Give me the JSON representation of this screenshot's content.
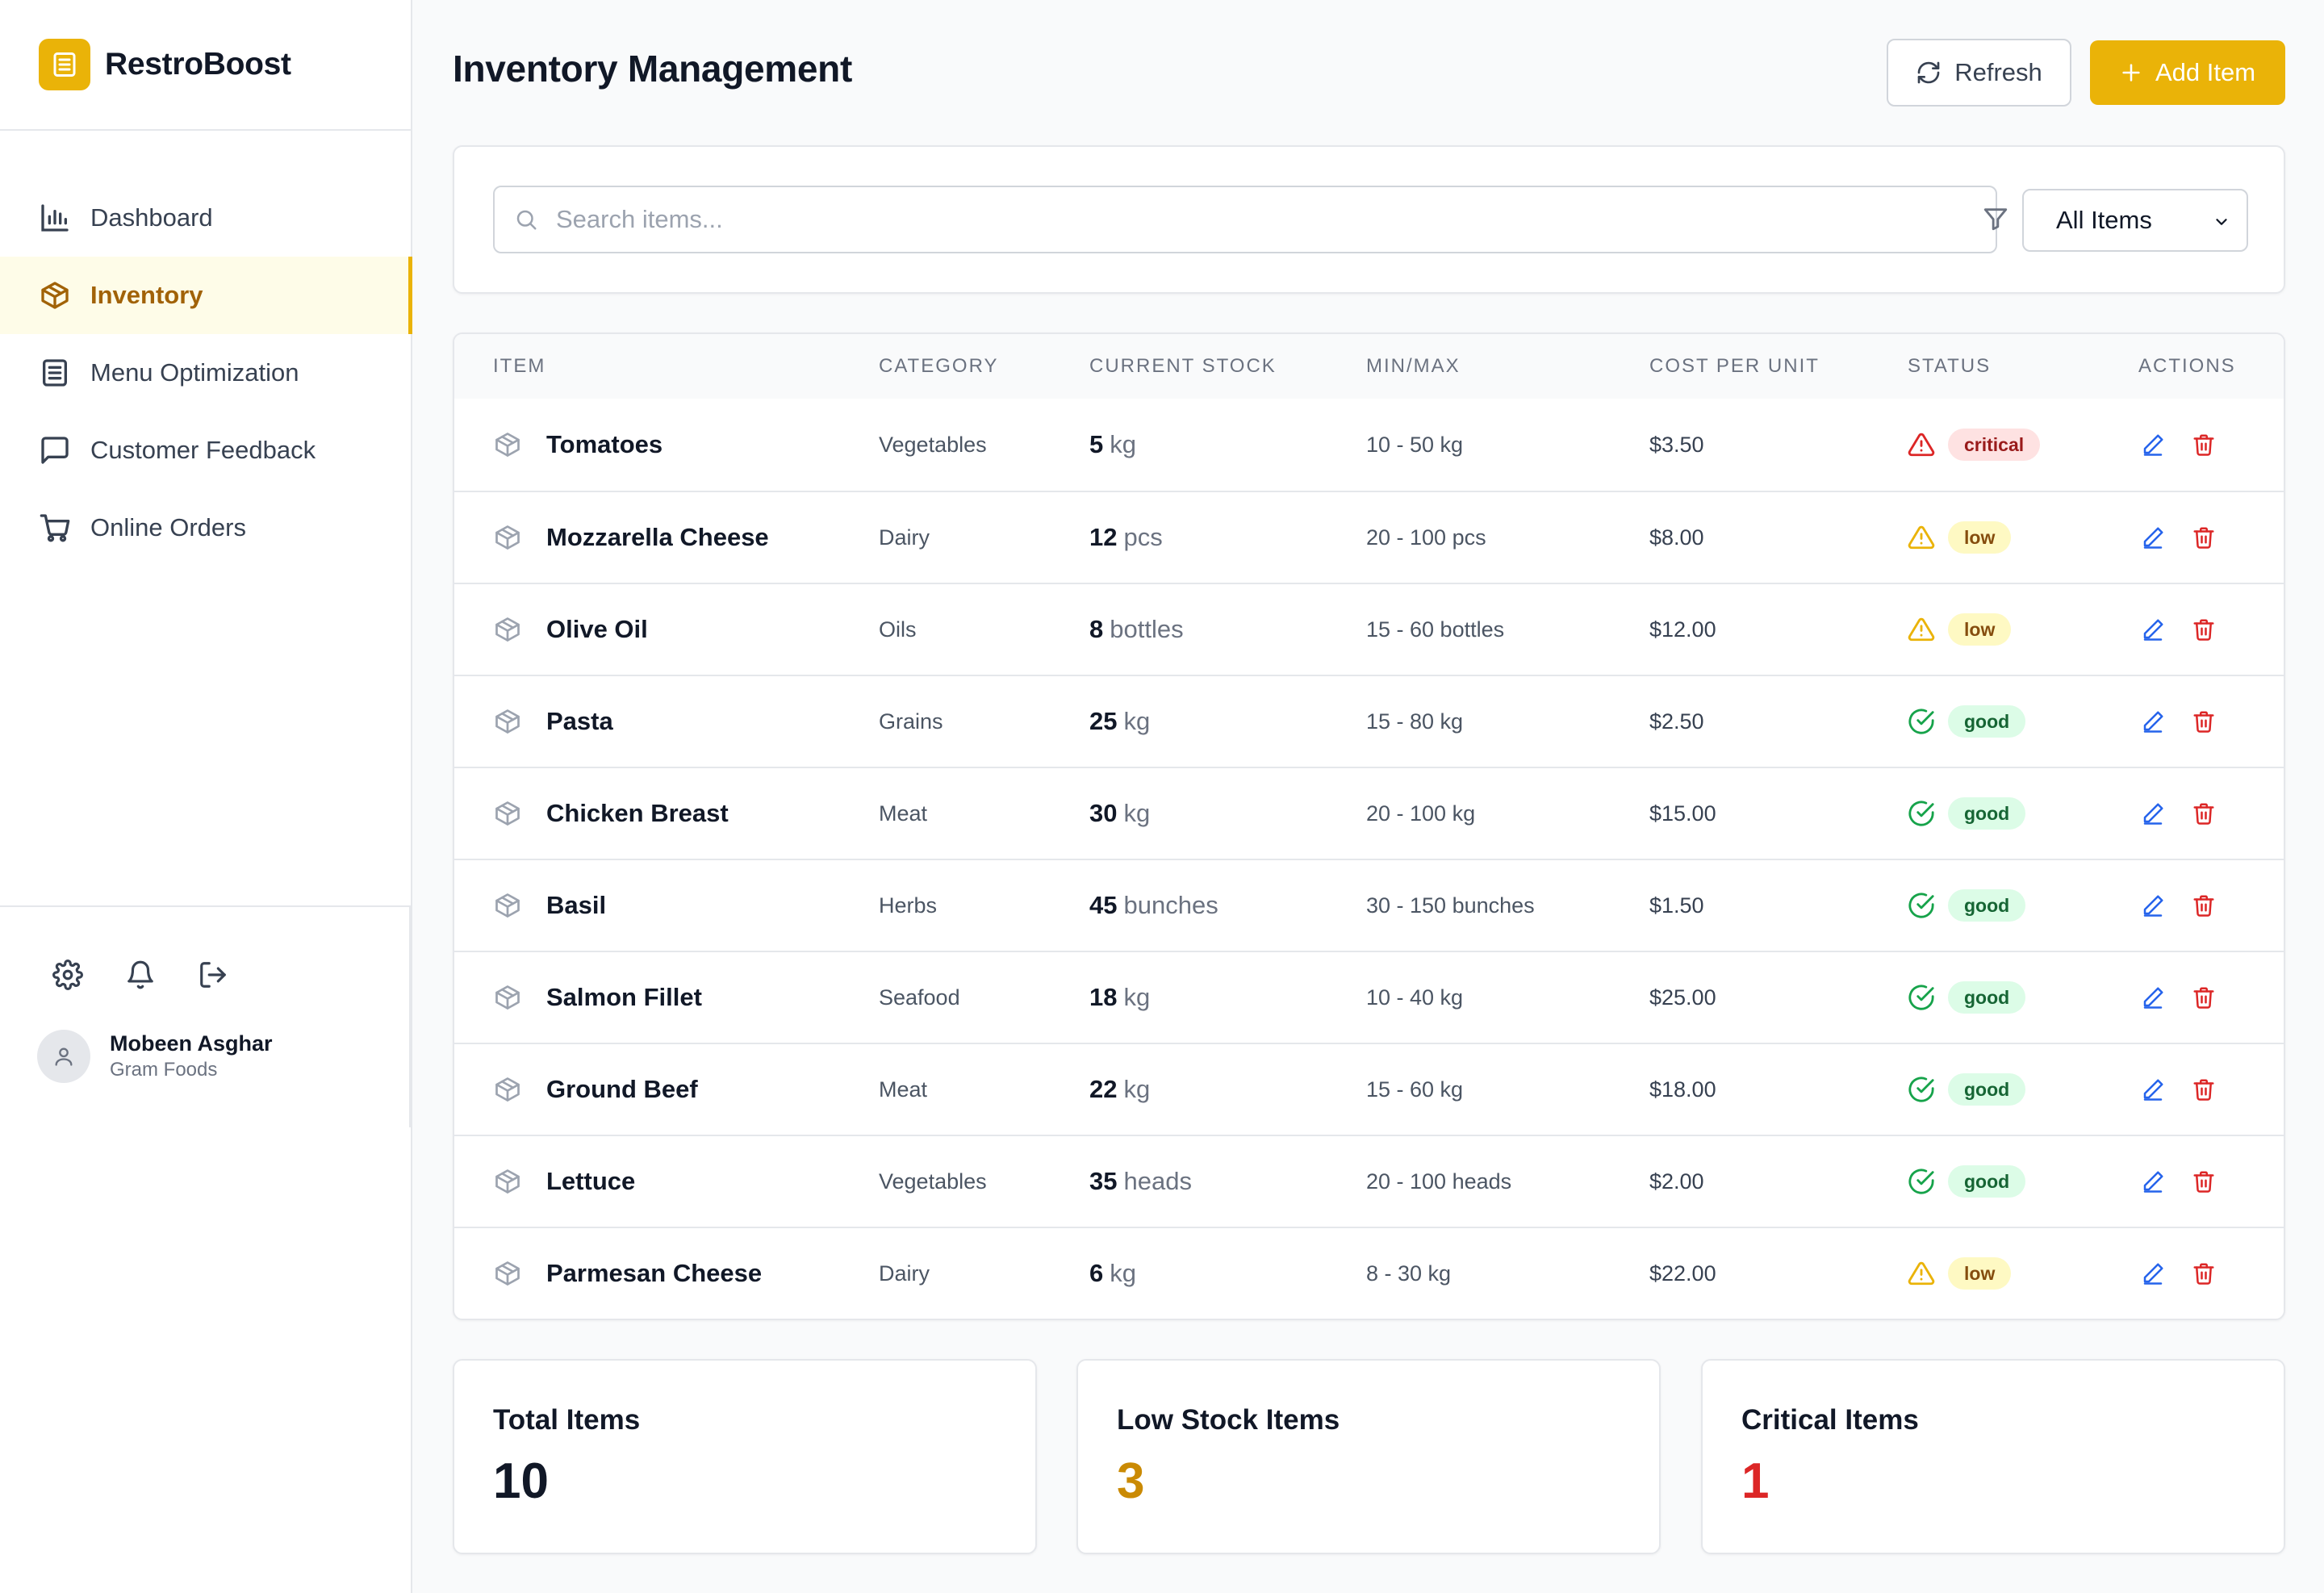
{
  "app": {
    "name": "RestroBoost"
  },
  "sidebar": {
    "items": [
      {
        "label": "Dashboard",
        "icon": "bar-chart-icon",
        "active": false
      },
      {
        "label": "Inventory",
        "icon": "package-icon",
        "active": true
      },
      {
        "label": "Menu Optimization",
        "icon": "list-icon",
        "active": false
      },
      {
        "label": "Customer Feedback",
        "icon": "message-square-icon",
        "active": false
      },
      {
        "label": "Online Orders",
        "icon": "shopping-cart-icon",
        "active": false
      }
    ],
    "utilities": [
      "settings-icon",
      "bell-icon",
      "logout-icon"
    ],
    "user": {
      "name": "Mobeen Asghar",
      "org": "Gram Foods"
    }
  },
  "header": {
    "title": "Inventory Management",
    "refresh_label": "Refresh",
    "add_label": "Add Item"
  },
  "filters": {
    "search_placeholder": "Search items...",
    "search_value": "",
    "filter_selected": "All Items"
  },
  "table": {
    "columns": [
      "ITEM",
      "CATEGORY",
      "CURRENT STOCK",
      "MIN/MAX",
      "COST PER UNIT",
      "STATUS",
      "ACTIONS"
    ],
    "rows": [
      {
        "item": "Tomatoes",
        "category": "Vegetables",
        "stock": "5",
        "unit": "kg",
        "minmax": "10 - 50 kg",
        "cost": "$3.50",
        "status": "critical"
      },
      {
        "item": "Mozzarella Cheese",
        "category": "Dairy",
        "stock": "12",
        "unit": "pcs",
        "minmax": "20 - 100 pcs",
        "cost": "$8.00",
        "status": "low"
      },
      {
        "item": "Olive Oil",
        "category": "Oils",
        "stock": "8",
        "unit": "bottles",
        "minmax": "15 - 60 bottles",
        "cost": "$12.00",
        "status": "low"
      },
      {
        "item": "Pasta",
        "category": "Grains",
        "stock": "25",
        "unit": "kg",
        "minmax": "15 - 80 kg",
        "cost": "$2.50",
        "status": "good"
      },
      {
        "item": "Chicken Breast",
        "category": "Meat",
        "stock": "30",
        "unit": "kg",
        "minmax": "20 - 100 kg",
        "cost": "$15.00",
        "status": "good"
      },
      {
        "item": "Basil",
        "category": "Herbs",
        "stock": "45",
        "unit": "bunches",
        "minmax": "30 - 150 bunches",
        "cost": "$1.50",
        "status": "good"
      },
      {
        "item": "Salmon Fillet",
        "category": "Seafood",
        "stock": "18",
        "unit": "kg",
        "minmax": "10 - 40 kg",
        "cost": "$25.00",
        "status": "good"
      },
      {
        "item": "Ground Beef",
        "category": "Meat",
        "stock": "22",
        "unit": "kg",
        "minmax": "15 - 60 kg",
        "cost": "$18.00",
        "status": "good"
      },
      {
        "item": "Lettuce",
        "category": "Vegetables",
        "stock": "35",
        "unit": "heads",
        "minmax": "20 - 100 heads",
        "cost": "$2.00",
        "status": "good"
      },
      {
        "item": "Parmesan Cheese",
        "category": "Dairy",
        "stock": "6",
        "unit": "kg",
        "minmax": "8 - 30 kg",
        "cost": "$22.00",
        "status": "low"
      }
    ]
  },
  "stats": [
    {
      "label": "Total Items",
      "value": "10",
      "color": "#111827"
    },
    {
      "label": "Low Stock Items",
      "value": "3",
      "color": "#ca8a04"
    },
    {
      "label": "Critical Items",
      "value": "1",
      "color": "#dc2626"
    }
  ],
  "colors": {
    "accent": "#eab308",
    "critical": "#dc2626",
    "low": "#eab308",
    "good": "#16a34a",
    "edit": "#2563eb",
    "delete": "#dc2626"
  }
}
